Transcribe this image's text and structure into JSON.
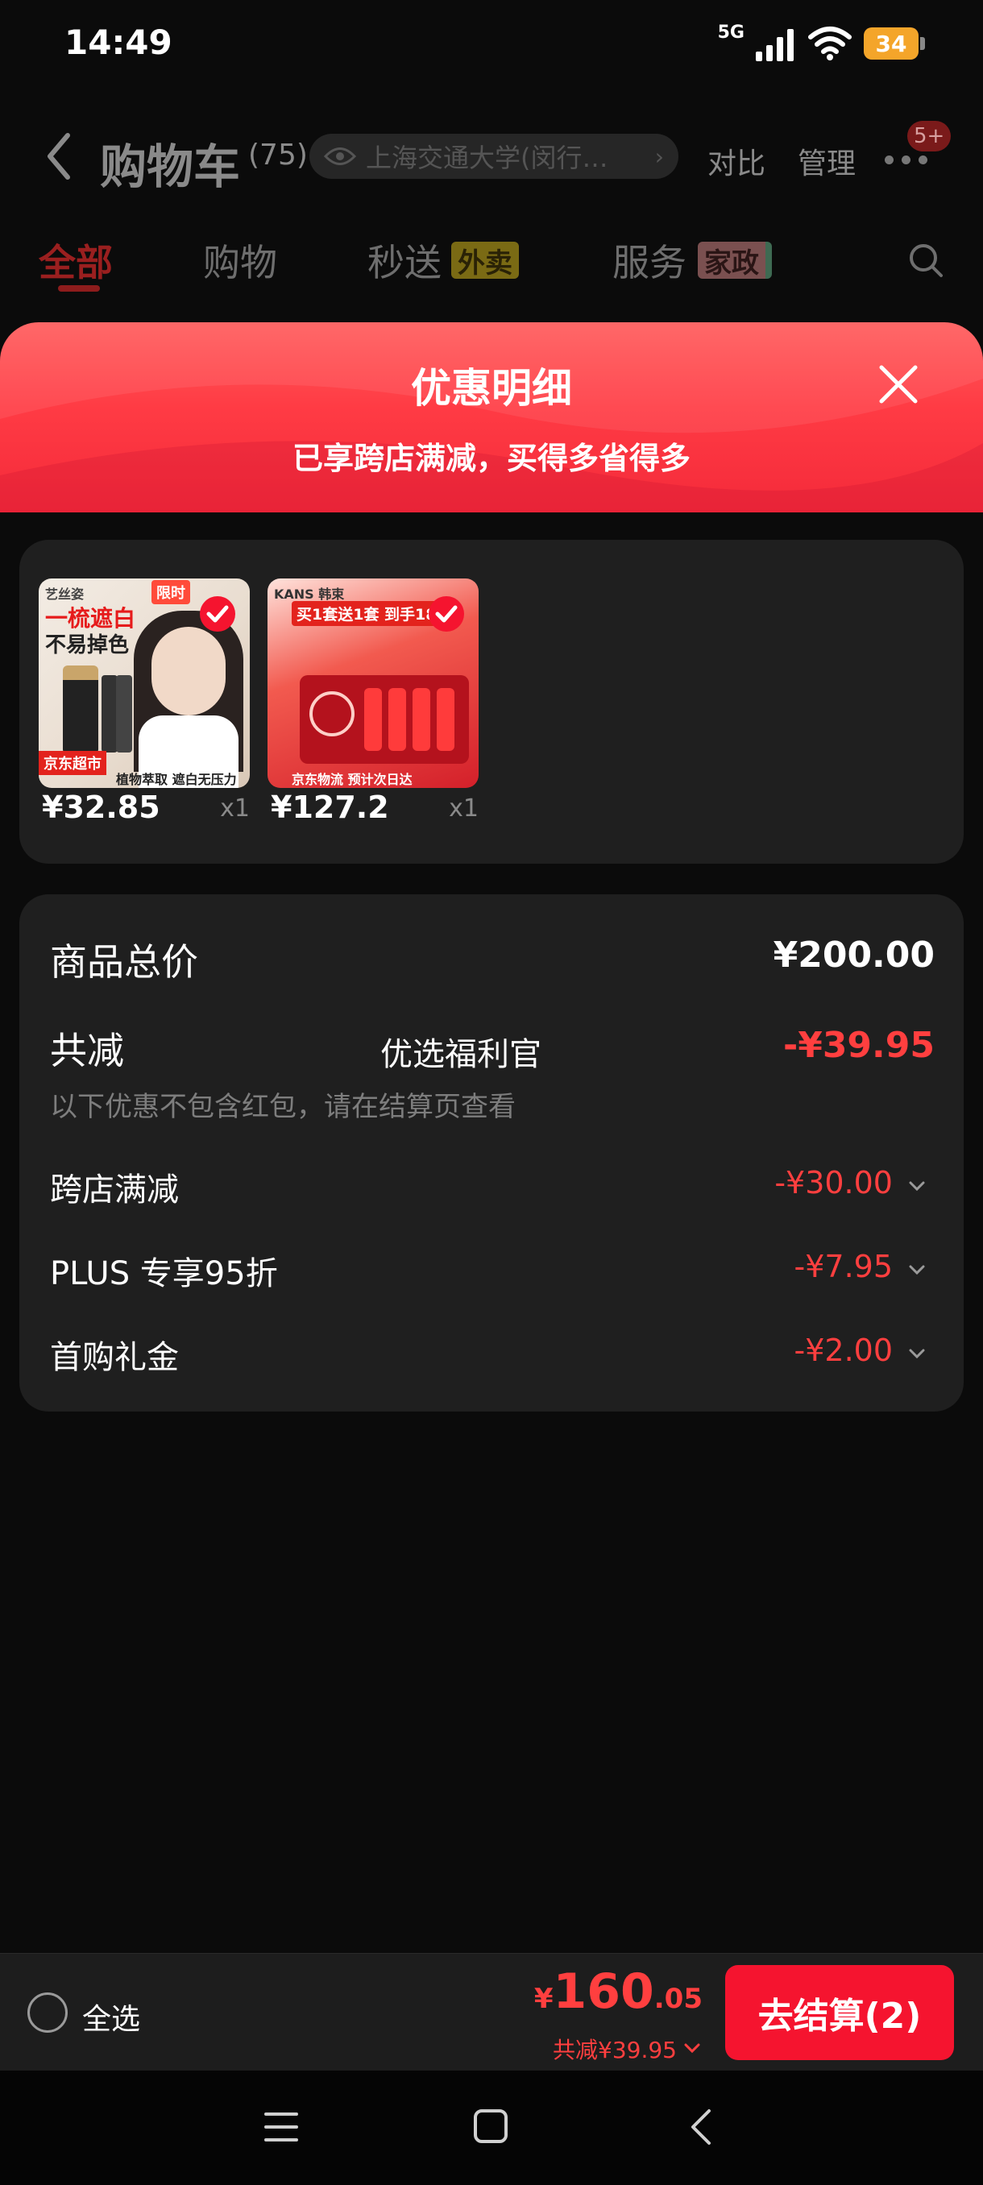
{
  "status_bar": {
    "time": "14:49",
    "network": "5G",
    "battery": "34"
  },
  "header": {
    "title": "购物车",
    "count": "(75)",
    "address": "上海交通大学(闵行…",
    "compare": "对比",
    "manage": "管理",
    "more_badge": "5+"
  },
  "tabs": [
    {
      "label": "全部"
    },
    {
      "label": "购物"
    },
    {
      "label": "秒送",
      "tag": "外卖"
    },
    {
      "label": "服务",
      "tag": "家政"
    }
  ],
  "sheet": {
    "title": "优惠明细",
    "subtitle": "已享跨店满减，买得多省得多"
  },
  "products": [
    {
      "price": "¥32.85",
      "qty": "x1",
      "thumb_texts": {
        "brand": "艺丝姿",
        "headline1": "一梳遮白",
        "headline2": "不易掉色",
        "bottom_tag": "京东超市",
        "bottom_note": "植物萃取 遮白无压力",
        "corner": "限时"
      }
    },
    {
      "price": "¥127.2",
      "qty": "x1",
      "thumb_texts": {
        "brand": "KANS 韩束",
        "banner": "买1套送1套 到手18件",
        "bottom_note": "京东物流 预计次日达"
      }
    }
  ],
  "summary": {
    "total_label": "商品总价",
    "total_value": "¥200.00",
    "reduce_label": "共减",
    "welfare_label": "优选福利官",
    "reduce_value": "-¥39.95",
    "note": "以下优惠不包含红包，请在结算页查看",
    "discounts": [
      {
        "label": "跨店满减",
        "value": "-¥30.00"
      },
      {
        "label": "PLUS 专享95折",
        "value": "-¥7.95"
      },
      {
        "label": "首购礼金",
        "value": "-¥2.00"
      }
    ]
  },
  "bottom_bar": {
    "select_all": "全选",
    "price_symbol": "¥",
    "price_int": "160",
    "price_dec": ".05",
    "saving": "共减¥39.95",
    "checkout": "去结算(2)"
  },
  "colors": {
    "accent": "#f5142f",
    "discount": "#ff3f3f",
    "sheet_red": "#ff3b44",
    "card_bg": "#1f1f1f"
  },
  "icons": [
    "back-icon",
    "eye-icon",
    "more-icon",
    "search-icon",
    "close-icon",
    "check-icon",
    "chevron-down-icon",
    "menu-icon",
    "home-icon"
  ]
}
